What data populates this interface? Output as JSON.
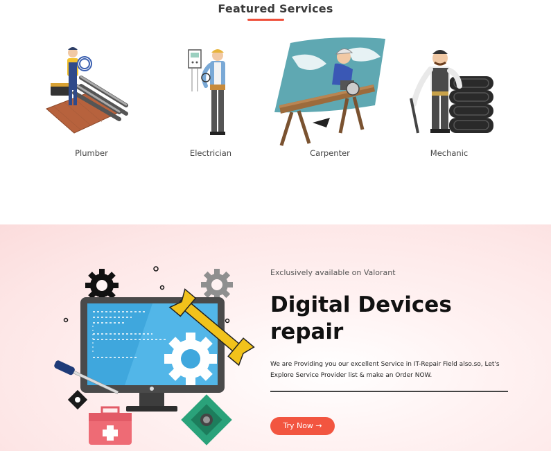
{
  "featured": {
    "title": "Featured Services",
    "accent_color": "#ef4f3a",
    "services": [
      {
        "label": "Plumber",
        "icon": "plumber-illustration"
      },
      {
        "label": "Electrician",
        "icon": "electrician-illustration"
      },
      {
        "label": "Carpenter",
        "icon": "carpenter-illustration"
      },
      {
        "label": "Mechanic",
        "icon": "mechanic-illustration"
      }
    ]
  },
  "promo": {
    "eyebrow": "Exclusively available on Valorant",
    "headline": "Digital Devices repair",
    "description": "We are Providing you our excellent Service in IT-Repair Field also.so, Let's Explore Service Provider list & make an Order NOW.",
    "cta_label": "Try Now →",
    "cta_color": "#f25540",
    "art": "computer-repair-illustration"
  }
}
